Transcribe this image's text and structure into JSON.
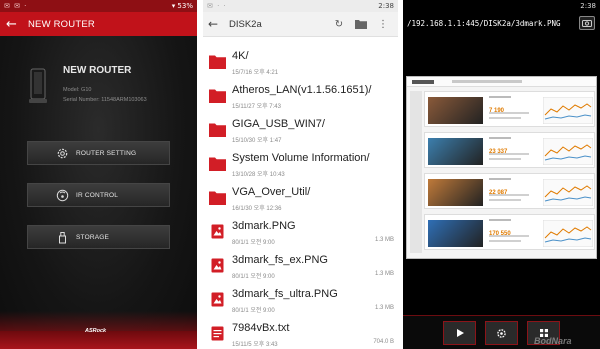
{
  "router_app": {
    "status_icons": "✉ ✉ ·",
    "status_right": "▾ 53%",
    "title": "NEW ROUTER",
    "device_name": "NEW ROUTER",
    "model": "Model: G10",
    "serial": "Serial Number: 11548ARM103063",
    "menu": [
      {
        "label": "ROUTER SETTING",
        "icon": "gear-icon"
      },
      {
        "label": "IR CONTROL",
        "icon": "remote-icon"
      },
      {
        "label": "STORAGE",
        "icon": "usb-drive-icon"
      }
    ],
    "brand": "ASRock",
    "accent_color": "#c1121a"
  },
  "file_browser": {
    "status_icons": "✉ · ·",
    "status_time": "2:38",
    "folder": "DISK2a",
    "items": [
      {
        "name": "4K/",
        "date": "15/7/16 오후 4:21",
        "size": "",
        "type": "folder"
      },
      {
        "name": "Atheros_LAN(v1.1.56.1651)/",
        "date": "15/11/27 오후 7:43",
        "size": "",
        "type": "folder"
      },
      {
        "name": "GIGA_USB_WIN7/",
        "date": "15/10/30 오후 1:47",
        "size": "",
        "type": "folder"
      },
      {
        "name": "System Volume Information/",
        "date": "13/10/28 오후 10:43",
        "size": "",
        "type": "folder"
      },
      {
        "name": "VGA_Over_Util/",
        "date": "16/1/30 오후 12:36",
        "size": "",
        "type": "folder"
      },
      {
        "name": "3dmark.PNG",
        "date": "80/1/1 오전 9:00",
        "size": "1.3 MB",
        "type": "image"
      },
      {
        "name": "3dmark_fs_ex.PNG",
        "date": "80/1/1 오전 9:00",
        "size": "1.3 MB",
        "type": "image"
      },
      {
        "name": "3dmark_fs_ultra.PNG",
        "date": "80/1/1 오전 9:00",
        "size": "1.3 MB",
        "type": "image"
      },
      {
        "name": "7984vBx.txt",
        "date": "15/11/5 오후 3:43",
        "size": "704.0 B",
        "type": "text"
      }
    ]
  },
  "image_viewer": {
    "status_time": "2:38",
    "path": "/192.168.1.1:445/DISK2a/3dmark.PNG",
    "scores": [
      "7 190",
      "23 337",
      "22 087",
      "170 550"
    ],
    "controls": [
      "play-icon",
      "settings-icon",
      "grid-icon"
    ]
  },
  "watermark": "BodNara"
}
